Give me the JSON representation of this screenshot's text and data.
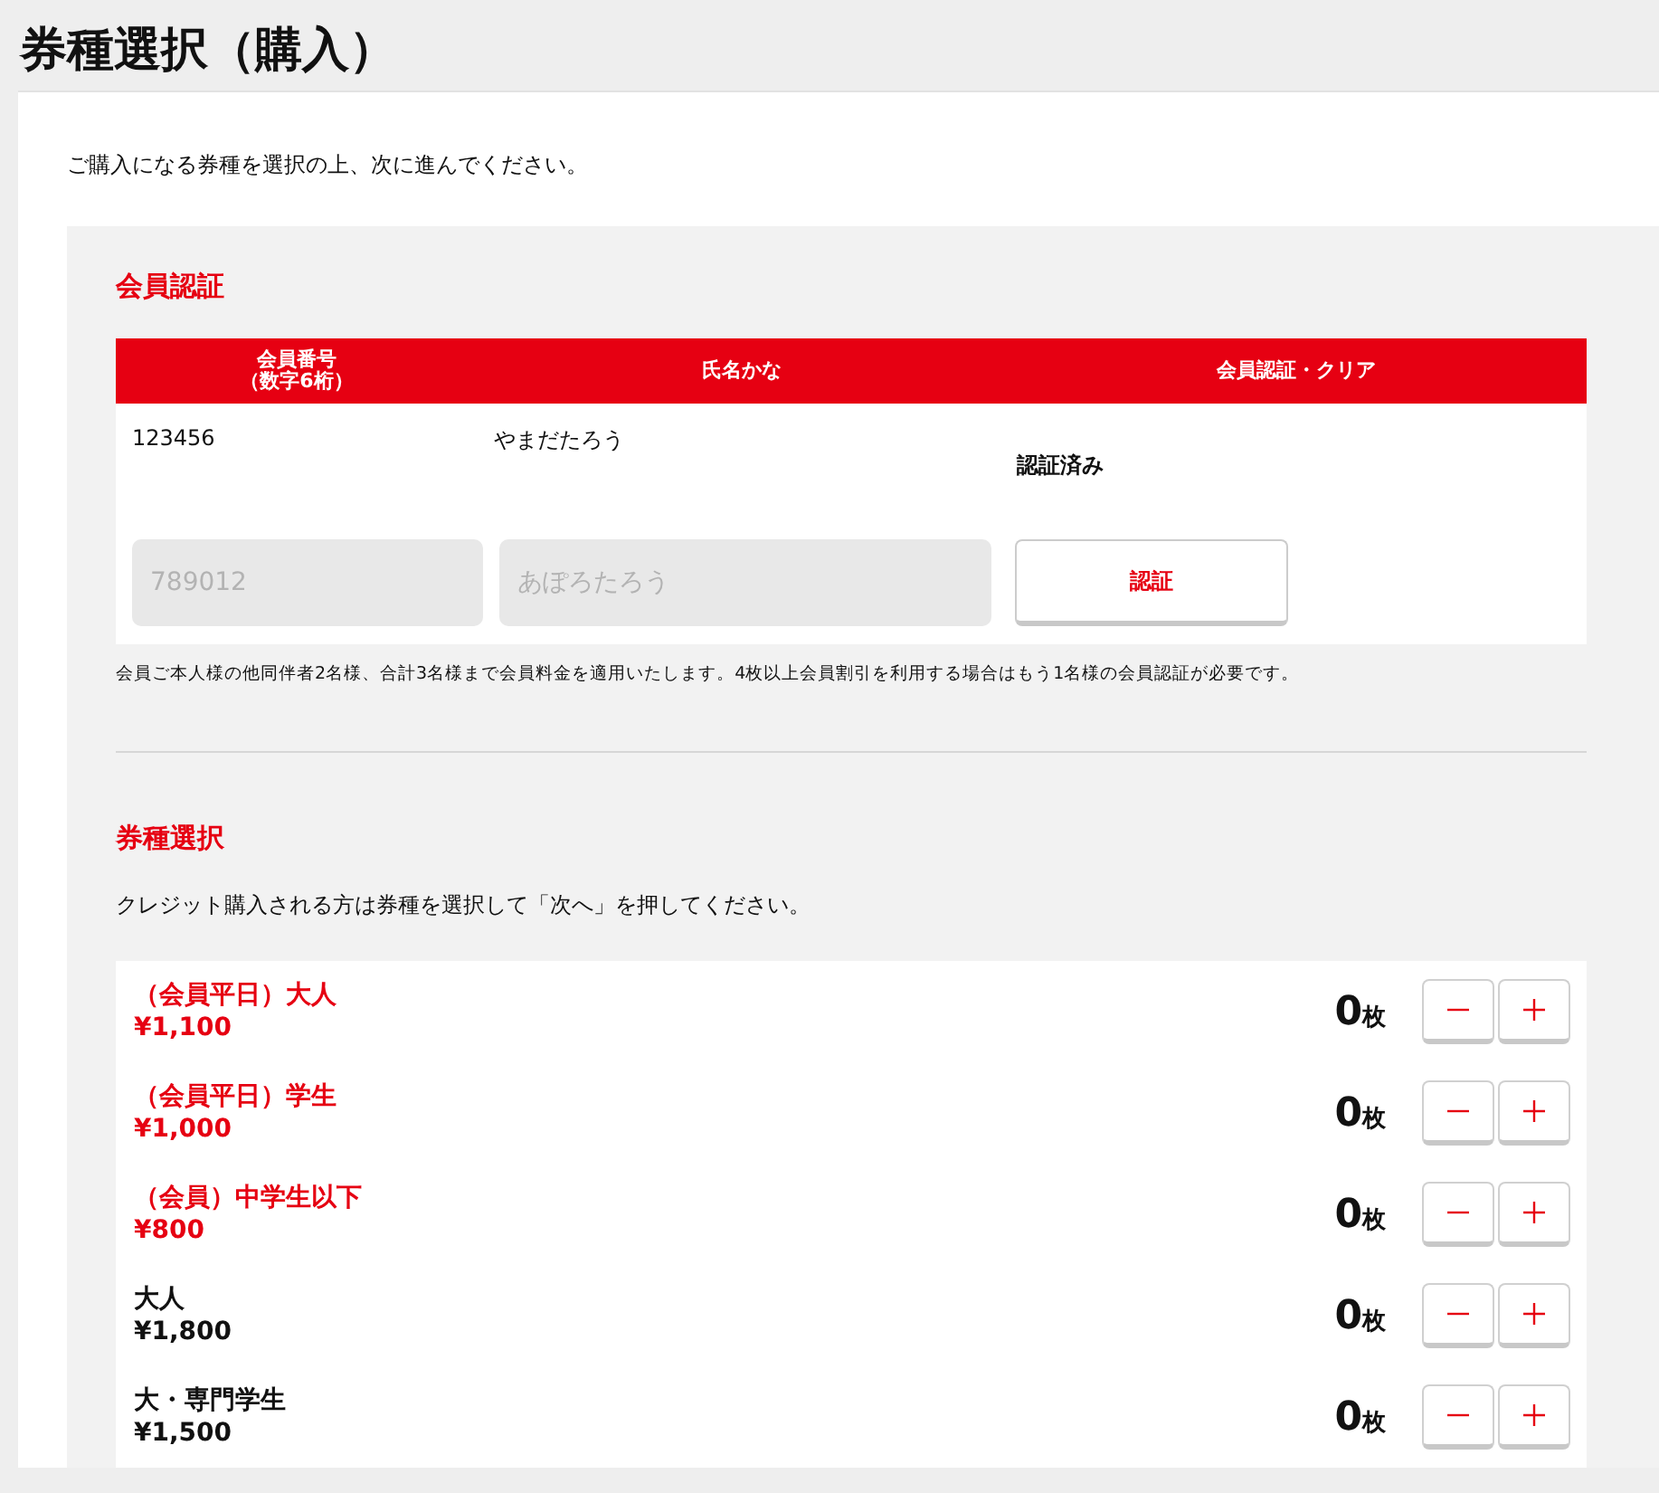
{
  "page_title": "券種選択（購入）",
  "intro": "ご購入になる券種を選択の上、次に進んでください。",
  "member_auth": {
    "heading": "会員認証",
    "columns": [
      [
        "会員番号",
        "（数字6桁）"
      ],
      [
        "氏名かな"
      ],
      [
        "会員認証・クリア"
      ]
    ],
    "rows": [
      {
        "number": "123456",
        "name": "やまだたろう",
        "status": "認証済み"
      }
    ],
    "entry": {
      "number_placeholder": "789012",
      "name_placeholder": "あぽろたろう",
      "button": "認証"
    },
    "note": "会員ご本人様の他同伴者2名様、合計3名様まで会員料金を適用いたします。4枚以上会員割引を利用する場合はもう1名様の会員認証が必要です。"
  },
  "ticket_select": {
    "heading": "券種選択",
    "instruction": "クレジット購入される方は券種を選択して「次へ」を押してください。",
    "tickets": [
      {
        "kind": "member",
        "name": "（会員平日）大人",
        "price": "¥1,100",
        "count": "0",
        "unit": "枚"
      },
      {
        "kind": "member",
        "name": "（会員平日）学生",
        "price": "¥1,000",
        "count": "0",
        "unit": "枚"
      },
      {
        "kind": "member",
        "name": "（会員）中学生以下",
        "price": "¥800",
        "count": "0",
        "unit": "枚"
      },
      {
        "kind": "general",
        "name": "大人",
        "price": "¥1,800",
        "count": "0",
        "unit": "枚"
      },
      {
        "kind": "general",
        "name": "大・専門学生",
        "price": "¥1,500",
        "count": "0",
        "unit": "枚"
      }
    ]
  }
}
